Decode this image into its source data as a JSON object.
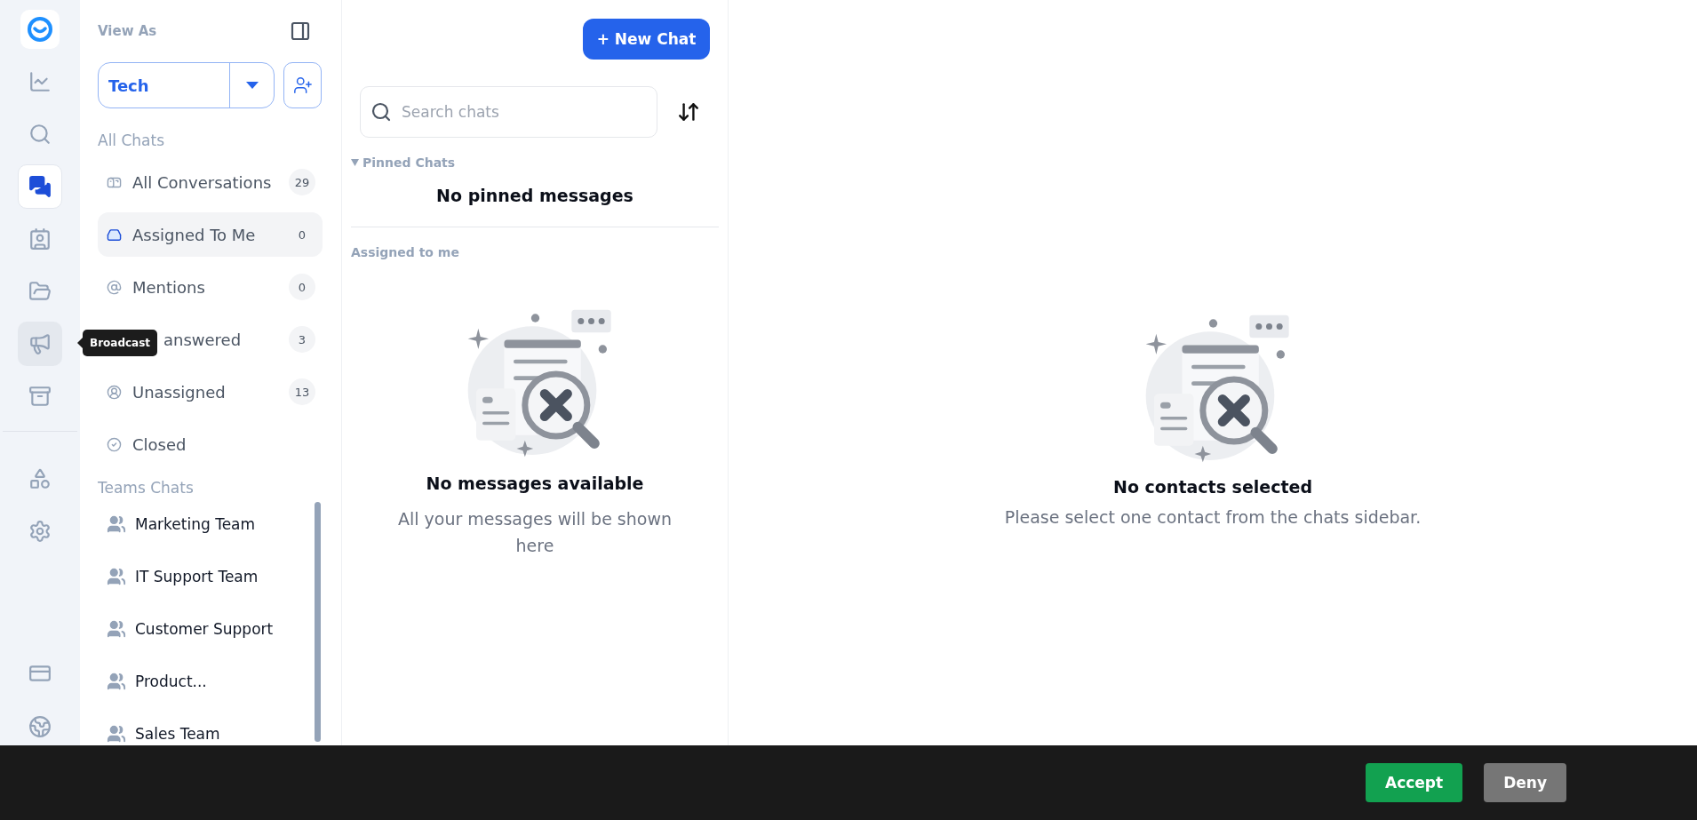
{
  "rail": {
    "top": [
      {
        "kind": "logo"
      },
      {
        "kind": "analytics",
        "selected": false
      },
      {
        "kind": "search",
        "selected": false
      },
      {
        "kind": "chats",
        "selected": true
      },
      {
        "kind": "contacts",
        "selected": false
      },
      {
        "kind": "files",
        "selected": false
      },
      {
        "kind": "broadcast",
        "selected": false,
        "tooltip": "Broadcast"
      },
      {
        "kind": "inbox",
        "selected": false
      }
    ],
    "middle": [
      {
        "kind": "shapes",
        "selected": false
      },
      {
        "kind": "settings",
        "selected": false
      }
    ],
    "bottom": [
      {
        "kind": "billing",
        "selected": false
      },
      {
        "kind": "globe",
        "selected": false
      }
    ]
  },
  "sidebar": {
    "view_as_label": "View As",
    "role_select": {
      "value": "Tech"
    },
    "all_chats": {
      "title": "All Chats",
      "items": [
        {
          "kind": "mailbox",
          "label": "All Conversations",
          "count": "29",
          "selected": false
        },
        {
          "kind": "inbox",
          "label": "Assigned To Me",
          "count": "0",
          "selected": true
        },
        {
          "kind": "mention",
          "label": "Mentions",
          "count": "0",
          "selected": false
        },
        {
          "kind": "covered",
          "label": "answered",
          "count": "3",
          "selected": false
        },
        {
          "kind": "unassigned",
          "label": "Unassigned",
          "count": "13",
          "selected": false
        },
        {
          "kind": "closed",
          "label": "Closed",
          "selected": false
        }
      ]
    },
    "teams": {
      "title": "Teams Chats",
      "items": [
        {
          "label": "Marketing Team"
        },
        {
          "label": "IT Support Team"
        },
        {
          "label": "Customer Support"
        },
        {
          "label": "Product..."
        },
        {
          "label": "Sales Team"
        }
      ]
    }
  },
  "chat_list": {
    "new_chat_button": "+ New Chat",
    "search": {
      "placeholder": "Search chats"
    },
    "pinned": {
      "title": "Pinned Chats",
      "expanded": true,
      "empty": "No pinned messages"
    },
    "assigned": {
      "title": "Assigned to me",
      "empty_title": "No messages available",
      "empty_text": "All your messages will be shown here"
    }
  },
  "detail": {
    "empty_title": "No contacts selected",
    "empty_text": "Please select one contact from the chats sidebar."
  },
  "cookie_bar": {
    "buttons": [
      {
        "kind": "accept",
        "label": "Accept"
      },
      {
        "kind": "deny",
        "label": "Deny"
      }
    ]
  }
}
